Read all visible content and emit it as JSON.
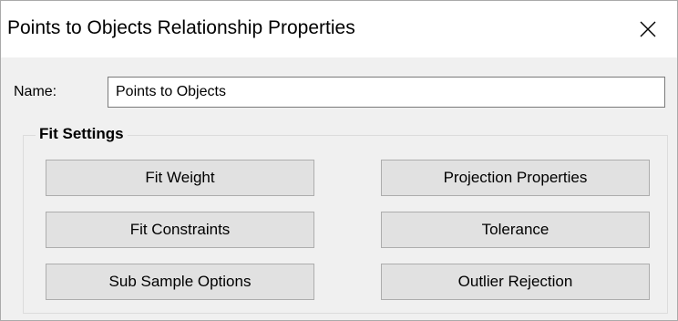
{
  "window": {
    "title": "Points to Objects Relationship Properties",
    "close_icon": "close-icon"
  },
  "name_field": {
    "label": "Name:",
    "value": "Points to Objects"
  },
  "fit_settings": {
    "legend": "Fit Settings",
    "buttons": [
      {
        "label": "Fit Weight"
      },
      {
        "label": "Projection Properties"
      },
      {
        "label": "Fit Constraints"
      },
      {
        "label": "Tolerance"
      },
      {
        "label": "Sub Sample Options"
      },
      {
        "label": "Outlier Rejection"
      }
    ]
  }
}
